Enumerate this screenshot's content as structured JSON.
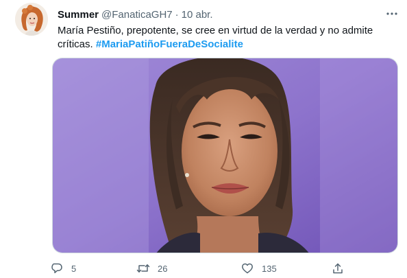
{
  "tweet": {
    "author_name": "Summer",
    "handle": "@FanaticaGH7",
    "separator": "·",
    "time": "10 abr.",
    "text": "María Pestiño, prepotente, se cree en virtud de la verdad y no admite críticas.",
    "hashtag": "#MariaPatiñoFueraDeSocialite",
    "image_alt": "Imagen"
  },
  "actions": {
    "reply_count": "5",
    "retweet_count": "26",
    "like_count": "135"
  },
  "icons": {
    "more": "more-horizontal-icon",
    "reply": "reply-icon",
    "retweet": "retweet-icon",
    "like": "heart-icon",
    "share": "share-icon"
  },
  "colors": {
    "text": "#0f1419",
    "secondary": "#536471",
    "link": "#1d9bf0",
    "border": "#cfd9de"
  }
}
